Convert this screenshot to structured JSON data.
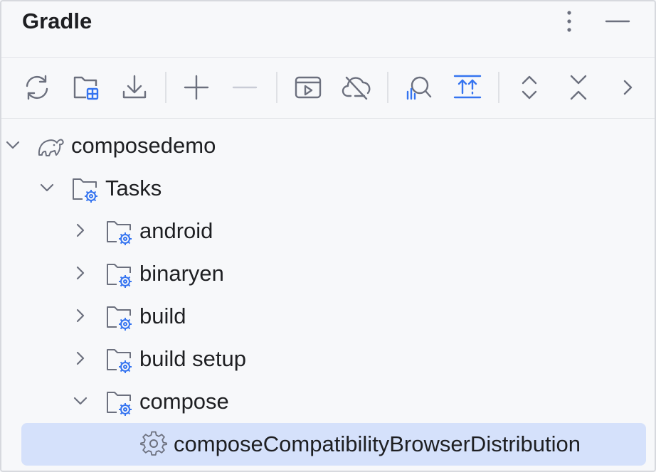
{
  "panel": {
    "title": "Gradle"
  },
  "toolbar": {
    "buttons": [
      {
        "name": "reload-all-gradle-projects",
        "icon": "refresh-icon"
      },
      {
        "name": "add-gradle-project",
        "icon": "folder-add-icon"
      },
      {
        "name": "download-sources",
        "icon": "download-icon"
      },
      {
        "name": "link-gradle-project",
        "icon": "plus-icon"
      },
      {
        "name": "unlink-gradle-project",
        "icon": "minus-icon",
        "disabled": true
      },
      {
        "name": "execute-gradle-task",
        "icon": "run-window-icon"
      },
      {
        "name": "toggle-offline-mode",
        "icon": "cloud-off-icon"
      },
      {
        "name": "analyze-dependencies",
        "icon": "analyze-icon"
      },
      {
        "name": "show-dependencies",
        "icon": "dependencies-icon"
      },
      {
        "name": "expand-all",
        "icon": "expand-all-icon"
      },
      {
        "name": "collapse-all",
        "icon": "collapse-all-icon"
      },
      {
        "name": "more-actions",
        "icon": "chevron-right-icon"
      }
    ]
  },
  "tree": {
    "items": [
      {
        "label": "composedemo",
        "level": 0,
        "expanded": true,
        "icon": "gradle-elephant-icon"
      },
      {
        "label": "Tasks",
        "level": 1,
        "expanded": true,
        "icon": "folder-gear-icon"
      },
      {
        "label": "android",
        "level": 2,
        "expanded": false,
        "icon": "folder-gear-icon"
      },
      {
        "label": "binaryen",
        "level": 2,
        "expanded": false,
        "icon": "folder-gear-icon"
      },
      {
        "label": "build",
        "level": 2,
        "expanded": false,
        "icon": "folder-gear-icon"
      },
      {
        "label": "build setup",
        "level": 2,
        "expanded": false,
        "icon": "folder-gear-icon"
      },
      {
        "label": "compose",
        "level": 2,
        "expanded": true,
        "icon": "folder-gear-icon"
      },
      {
        "label": "composeCompatibilityBrowserDistribution",
        "level": 3,
        "selected": true,
        "icon": "gear-icon"
      }
    ]
  },
  "colors": {
    "background": "#f7f8fa",
    "selection": "#d5e1fb",
    "icon": "#6c707e",
    "accent_blue": "#3574f0",
    "separator": "#dfe1e5",
    "text": "#1e1f22"
  }
}
